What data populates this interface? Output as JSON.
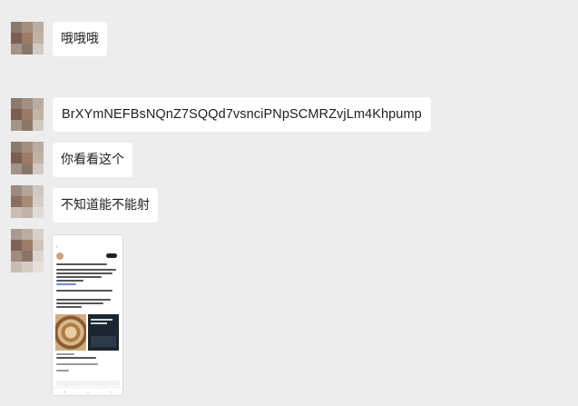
{
  "messages": [
    {
      "text": "哦哦哦",
      "kind": "text"
    },
    {
      "text": "BrXYmNEFBsNQnZ7SQQd7vsnciPNpSCMRZvjLm4Khpump",
      "kind": "text"
    },
    {
      "text": "你看看这个",
      "kind": "text"
    },
    {
      "text": "不知道能不能射",
      "kind": "text"
    },
    {
      "kind": "image",
      "description": "phone screenshot of a social media post"
    }
  ],
  "colors": {
    "background": "#ededed",
    "bubble": "#ffffff",
    "text": "#1f1f1f"
  }
}
